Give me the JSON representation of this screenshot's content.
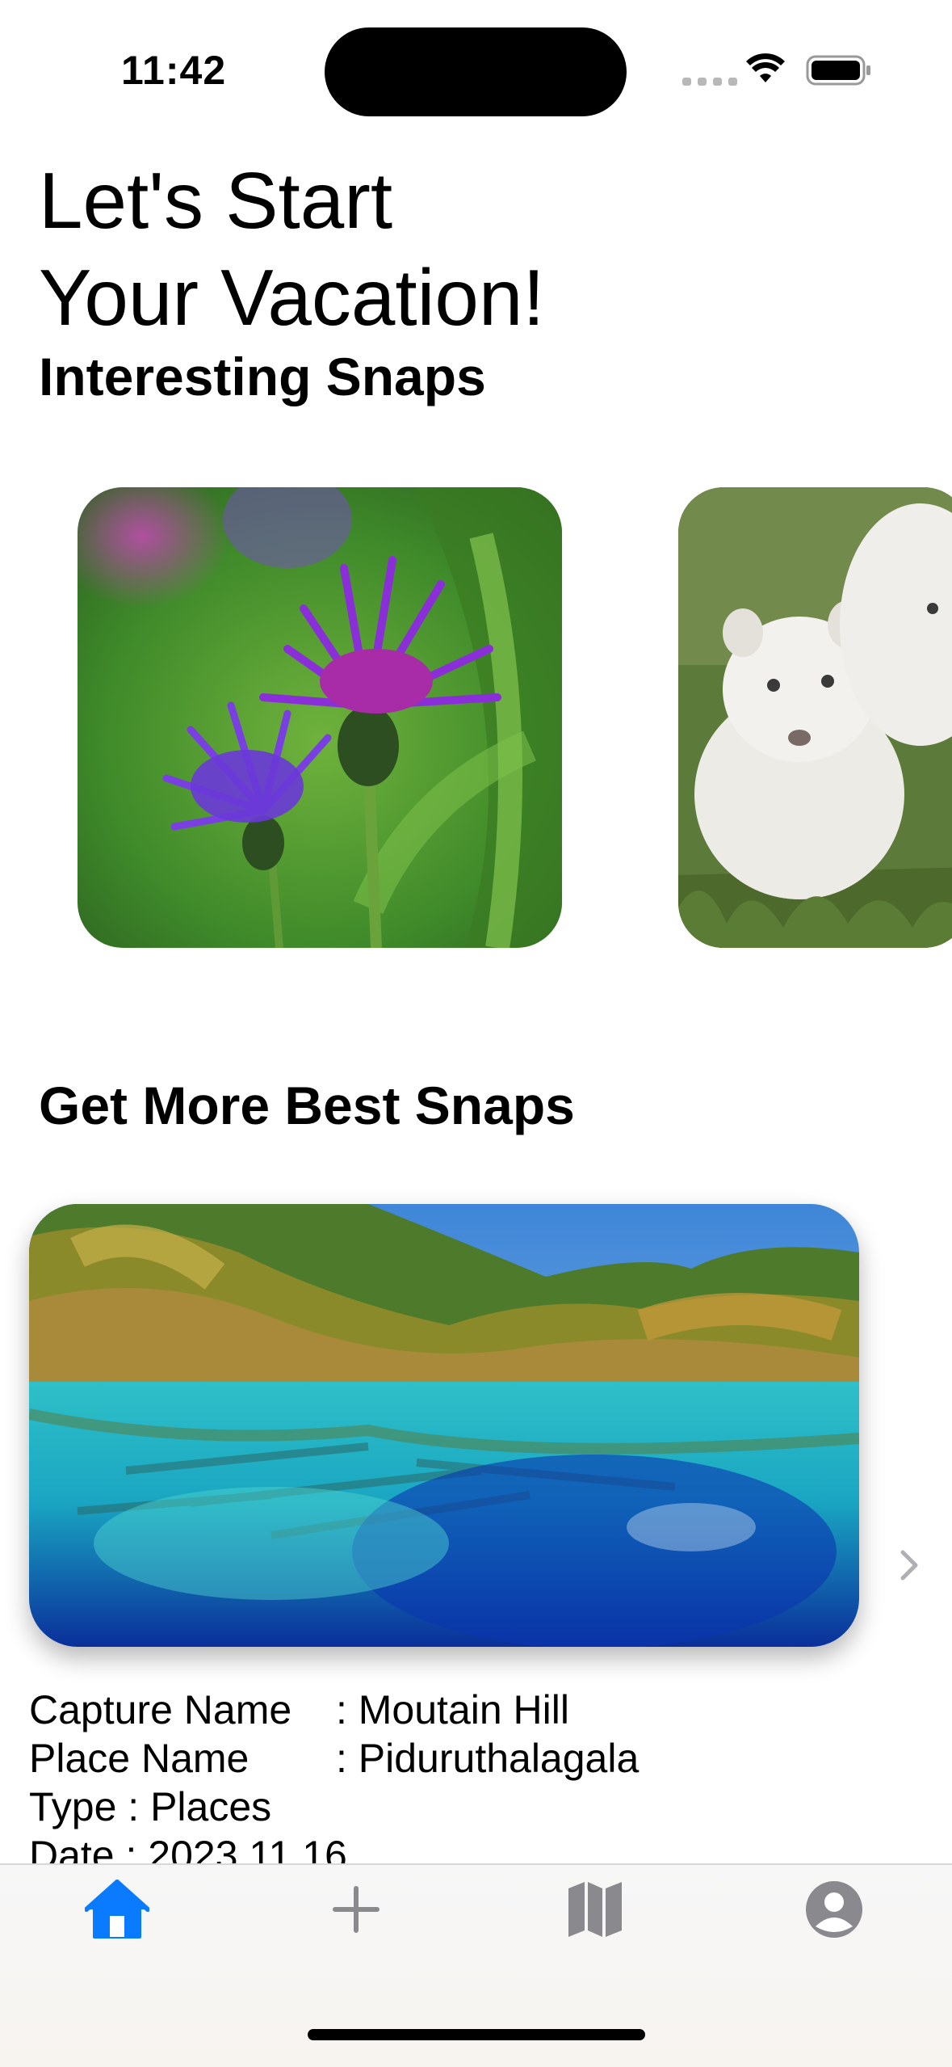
{
  "status_bar": {
    "time": "11:42"
  },
  "headline": {
    "line1": "Let's Start",
    "line2": "Your Vacation!"
  },
  "sections": {
    "interesting": "Interesting Snaps",
    "more": "Get More Best Snaps"
  },
  "snaps": [
    {
      "icon": "flower-photo"
    },
    {
      "icon": "white-lion-cub-photo"
    }
  ],
  "featured": {
    "icon": "lake-photo",
    "capture_label": "Capture Name",
    "capture_value": ": Moutain Hill",
    "place_label": "Place Name",
    "place_value": ": Piduruthalagala",
    "type_text": "Type : Places",
    "date_text": "Date : 2023.11.16"
  },
  "tabbar": {
    "active_color": "#0a7aff",
    "inactive_color": "#8a8a8e",
    "items": [
      {
        "icon": "house-icon",
        "active": true
      },
      {
        "icon": "plus-icon",
        "active": false
      },
      {
        "icon": "map-icon",
        "active": false
      },
      {
        "icon": "person-circle-icon",
        "active": false
      }
    ]
  }
}
